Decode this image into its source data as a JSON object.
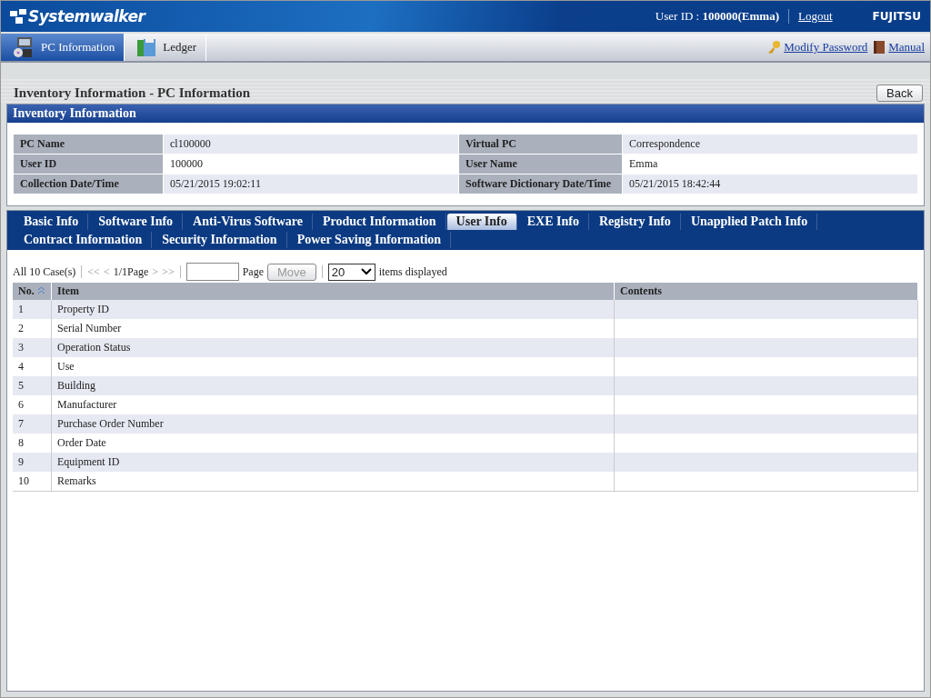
{
  "header": {
    "product": "Systemwalker",
    "user_label": "User ID : ",
    "user_value": "100000(Emma)",
    "logout": "Logout",
    "vendor": "FUJITSU"
  },
  "nav": {
    "items": [
      {
        "label": "PC Information",
        "kind": "pc",
        "selected": true
      },
      {
        "label": "Ledger",
        "kind": "ledger",
        "selected": false
      }
    ],
    "links": [
      {
        "label": "Modify Password",
        "kind": "key"
      },
      {
        "label": "Manual",
        "kind": "book"
      }
    ]
  },
  "page_title": "Inventory Information - PC Information",
  "back_button": "Back",
  "inventory": {
    "title": "Inventory Information",
    "rows": [
      {
        "label_1": "PC Name",
        "value_1": "cl100000",
        "label_2": "Virtual PC",
        "value_2": "Correspondence"
      },
      {
        "label_1": "User ID",
        "value_1": "100000",
        "label_2": "User Name",
        "value_2": "Emma"
      },
      {
        "label_1": "Collection Date/Time",
        "value_1": "05/21/2015 19:02:11",
        "label_2": "Software Dictionary Date/Time",
        "value_2": "05/21/2015 18:42:44"
      }
    ]
  },
  "tabs": [
    [
      {
        "label": "Basic Info",
        "selected": false
      },
      {
        "label": "Software Info",
        "selected": false
      },
      {
        "label": "Anti-Virus Software",
        "selected": false
      },
      {
        "label": "Product Information",
        "selected": false
      },
      {
        "label": "User Info",
        "selected": true
      },
      {
        "label": "EXE Info",
        "selected": false
      },
      {
        "label": "Registry Info",
        "selected": false
      },
      {
        "label": "Unapplied Patch Info",
        "selected": false
      }
    ],
    [
      {
        "label": "Contract Information",
        "selected": false
      },
      {
        "label": "Security Information",
        "selected": false
      },
      {
        "label": "Power Saving Information",
        "selected": false
      }
    ]
  ],
  "pager": {
    "count": "All 10 Case(s)",
    "first": "<<",
    "prev": "<",
    "page": "1/1Page",
    "next": ">",
    "last": ">>",
    "page_label": "Page",
    "move": "Move",
    "move_disabled": true,
    "per_page": "20",
    "per_page_label": "items displayed"
  },
  "table": {
    "columns": [
      "No.",
      "Item",
      "Contents"
    ],
    "rows": [
      {
        "no": "1",
        "item": "Property ID"
      },
      {
        "no": "2",
        "item": "Serial Number"
      },
      {
        "no": "3",
        "item": "Operation Status"
      },
      {
        "no": "4",
        "item": "Use"
      },
      {
        "no": "5",
        "item": "Building"
      },
      {
        "no": "6",
        "item": "Manufacturer"
      },
      {
        "no": "7",
        "item": "Purchase Order Number"
      },
      {
        "no": "8",
        "item": "Order Date"
      },
      {
        "no": "9",
        "item": "Equipment ID"
      },
      {
        "no": "10",
        "item": "Remarks"
      }
    ]
  }
}
